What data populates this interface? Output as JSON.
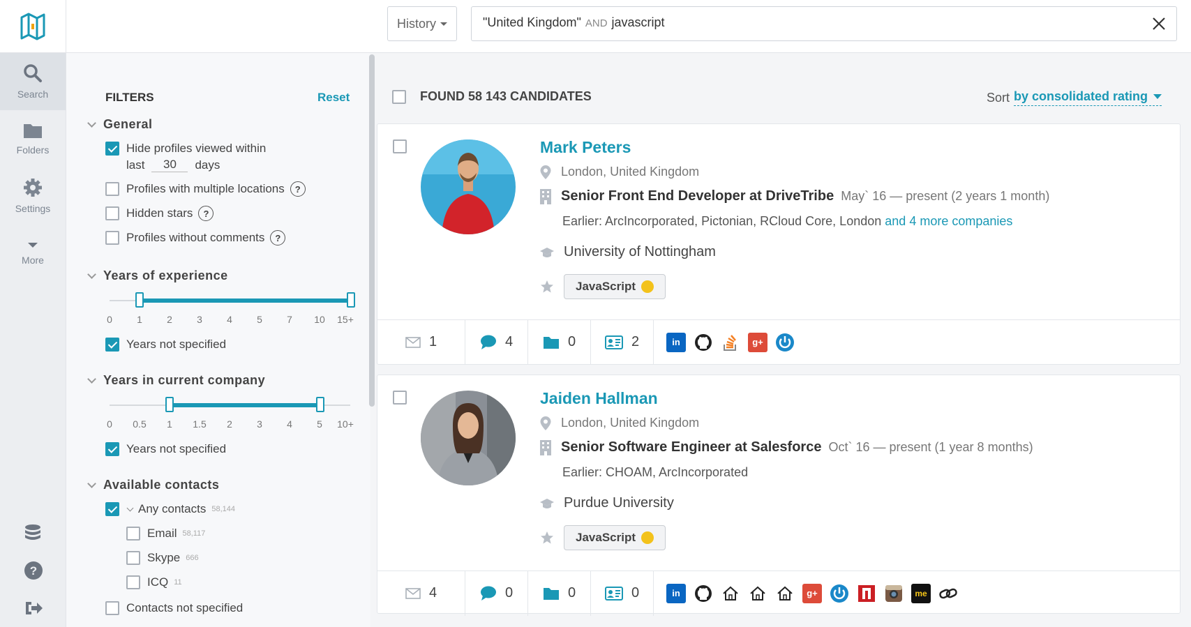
{
  "nav": {
    "items": [
      {
        "label": "Search",
        "icon": "search-icon"
      },
      {
        "label": "Folders",
        "icon": "folder-icon"
      },
      {
        "label": "Settings",
        "icon": "gear-icon"
      },
      {
        "label": "More",
        "icon": "chevron-down-icon"
      }
    ]
  },
  "topbar": {
    "history_label": "History",
    "query_term1": "\"United Kingdom\"",
    "query_operator": "AND",
    "query_term2": "javascript"
  },
  "filters": {
    "title": "FILTERS",
    "reset": "Reset",
    "general": {
      "title": "General",
      "hide_viewed": "Hide profiles viewed within",
      "last": "last",
      "days_value": "30",
      "days": "days",
      "multi_locations": "Profiles with multiple locations",
      "hidden_stars": "Hidden stars",
      "no_comments": "Profiles without comments",
      "help": "?"
    },
    "experience": {
      "title": "Years of experience",
      "ticks": [
        "0",
        "1",
        "2",
        "3",
        "4",
        "5",
        "7",
        "10",
        "15+"
      ],
      "range": [
        "1",
        "15+"
      ],
      "not_specified": "Years not specified"
    },
    "current_company": {
      "title": "Years in current company",
      "ticks": [
        "0",
        "0.5",
        "1",
        "1.5",
        "2",
        "3",
        "4",
        "5",
        "10+"
      ],
      "range": [
        "1",
        "5"
      ],
      "not_specified": "Years not specified"
    },
    "contacts": {
      "title": "Available contacts",
      "any": "Any contacts",
      "any_count": "58,144",
      "email": "Email",
      "email_count": "58,117",
      "skype": "Skype",
      "skype_count": "666",
      "icq": "ICQ",
      "icq_count": "11",
      "not_specified": "Contacts not specified"
    }
  },
  "results": {
    "found": "FOUND 58 143 CANDIDATES",
    "sort_label": "Sort",
    "sort_value": "by consolidated rating",
    "candidates": [
      {
        "name": "Mark Peters",
        "location": "London, United Kingdom",
        "title": "Senior Front End Developer at DriveTribe",
        "duration": "May` 16 — present (2 years 1 month)",
        "earlier": "Earlier: ArcIncorporated, Pictonian, RCloud Core, London",
        "more_companies": "and 4 more companies",
        "education": "University of Nottingham",
        "skill": "JavaScript",
        "stats": {
          "emails": "1",
          "comments": "4",
          "folders": "0",
          "contacts": "2"
        },
        "socials": [
          "linkedin-icon",
          "github-icon",
          "stackoverflow-icon",
          "googleplus-icon",
          "power-icon"
        ]
      },
      {
        "name": "Jaiden Hallman",
        "location": "London, United Kingdom",
        "title": "Senior Software Engineer at Salesforce",
        "duration": "Oct` 16 — present (1 year 8 months)",
        "earlier": "Earlier: CHOAM, ArcIncorporated",
        "more_companies": "",
        "education": "Purdue University",
        "skill": "JavaScript",
        "stats": {
          "emails": "4",
          "comments": "0",
          "folders": "0",
          "contacts": "0"
        },
        "socials": [
          "linkedin-icon",
          "github-icon",
          "home-icon",
          "home-icon",
          "home-icon",
          "googleplus-icon",
          "power-icon",
          "n-icon",
          "instagram-icon",
          "aboutme-icon",
          "link-icon"
        ],
        "aboutme_text": "me"
      }
    ]
  },
  "colors": {
    "accent": "#1a98b5",
    "linkedin": "#0a66c2",
    "googleplus": "#dd4b39"
  }
}
